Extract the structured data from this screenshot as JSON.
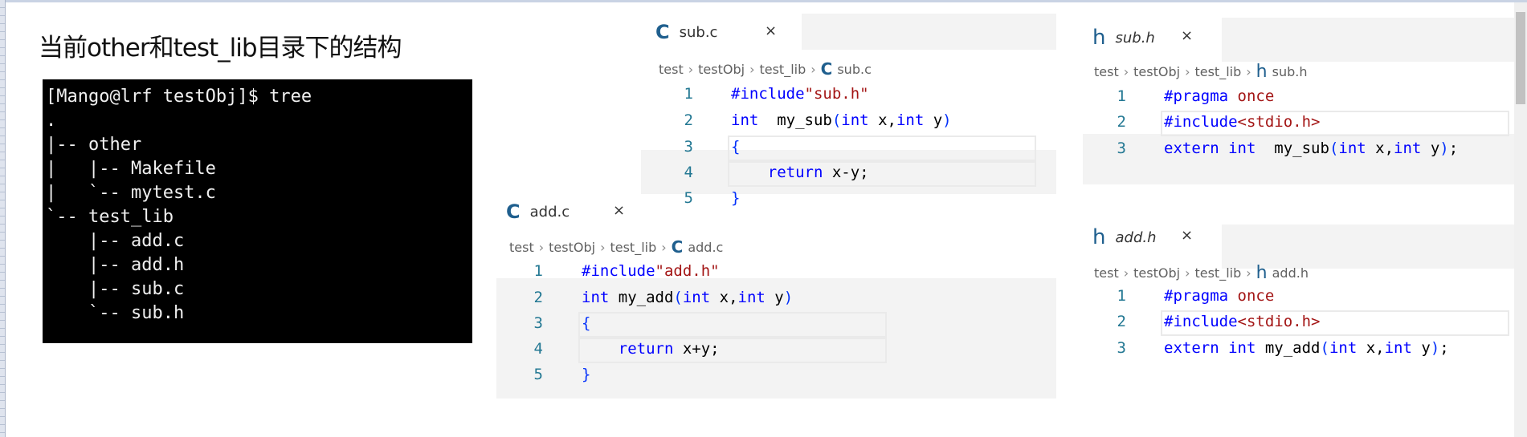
{
  "heading": "当前other和test_lib目录下的结构",
  "terminal": {
    "lines": [
      "[Mango@lrf testObj]$ tree",
      ".",
      "|-- other",
      "|   |-- Makefile",
      "|   `-- mytest.c",
      "`-- test_lib",
      "    |-- add.c",
      "    |-- add.h",
      "    |-- sub.c",
      "    `-- sub.h"
    ]
  },
  "colors": {
    "keyword": "#0000ff",
    "string": "#a31515",
    "bracket": "#0431fa",
    "line_number": "#237893",
    "file_icon": "#1f5f8e"
  },
  "panels": {
    "subc": {
      "tab": {
        "icon": "c-file-icon",
        "icon_text": "C",
        "label": "sub.c",
        "close": "×"
      },
      "breadcrumb": [
        "test",
        "testObj",
        "test_lib",
        "sub.c"
      ],
      "lines": [
        [
          [
            "kw",
            "#include"
          ],
          [
            "str",
            "\"sub.h\""
          ]
        ],
        [
          [
            "kw",
            "int"
          ],
          [
            "",
            "  my_sub"
          ],
          [
            "br",
            "("
          ],
          [
            "kw",
            "int"
          ],
          [
            "",
            " x,"
          ],
          [
            "kw",
            "int"
          ],
          [
            "",
            " y"
          ],
          [
            "br",
            ")"
          ]
        ],
        [
          [
            "br",
            "{"
          ]
        ],
        [
          [
            "",
            "    "
          ],
          [
            "kw",
            "return"
          ],
          [
            "",
            " x-y;"
          ]
        ],
        [
          [
            "br",
            "}"
          ]
        ]
      ]
    },
    "addc": {
      "tab": {
        "icon": "c-file-icon",
        "icon_text": "C",
        "label": "add.c",
        "close": "×"
      },
      "breadcrumb": [
        "test",
        "testObj",
        "test_lib",
        "add.c"
      ],
      "lines": [
        [
          [
            "kw",
            "#include"
          ],
          [
            "str",
            "\"add.h\""
          ]
        ],
        [
          [
            "kw",
            "int"
          ],
          [
            "",
            " my_add"
          ],
          [
            "br",
            "("
          ],
          [
            "kw",
            "int"
          ],
          [
            "",
            " x,"
          ],
          [
            "kw",
            "int"
          ],
          [
            "",
            " y"
          ],
          [
            "br",
            ")"
          ]
        ],
        [
          [
            "br",
            "{"
          ]
        ],
        [
          [
            "",
            "    "
          ],
          [
            "kw",
            "return"
          ],
          [
            "",
            " x+y;"
          ]
        ],
        [
          [
            "br",
            "}"
          ]
        ]
      ]
    },
    "subh": {
      "tab": {
        "icon": "h-file-icon",
        "icon_text": "h",
        "label": "sub.h",
        "close": "×"
      },
      "breadcrumb": [
        "test",
        "testObj",
        "test_lib",
        "sub.h"
      ],
      "lines": [
        [
          [
            "kw",
            "#pragma"
          ],
          [
            "",
            " "
          ],
          [
            "str",
            "once"
          ]
        ],
        [
          [
            "kw",
            "#include"
          ],
          [
            "ang",
            "<stdio.h>"
          ]
        ],
        [
          [
            "kw",
            "extern"
          ],
          [
            "",
            " "
          ],
          [
            "kw",
            "int"
          ],
          [
            "",
            "  my_sub"
          ],
          [
            "br",
            "("
          ],
          [
            "kw",
            "int"
          ],
          [
            "",
            " x,"
          ],
          [
            "kw",
            "int"
          ],
          [
            "",
            " y"
          ],
          [
            "br",
            ")"
          ],
          [
            "",
            ";"
          ]
        ]
      ]
    },
    "addh": {
      "tab": {
        "icon": "h-file-icon",
        "icon_text": "h",
        "label": "add.h",
        "close": "×"
      },
      "breadcrumb": [
        "test",
        "testObj",
        "test_lib",
        "add.h"
      ],
      "lines": [
        [
          [
            "kw",
            "#pragma"
          ],
          [
            "",
            " "
          ],
          [
            "str",
            "once"
          ]
        ],
        [
          [
            "kw",
            "#include"
          ],
          [
            "ang",
            "<stdio.h>"
          ]
        ],
        [
          [
            "kw",
            "extern"
          ],
          [
            "",
            " "
          ],
          [
            "kw",
            "int"
          ],
          [
            "",
            " my_add"
          ],
          [
            "br",
            "("
          ],
          [
            "kw",
            "int"
          ],
          [
            "",
            " x,"
          ],
          [
            "kw",
            "int"
          ],
          [
            "",
            " y"
          ],
          [
            "br",
            ")"
          ],
          [
            "",
            ";"
          ]
        ]
      ]
    }
  }
}
